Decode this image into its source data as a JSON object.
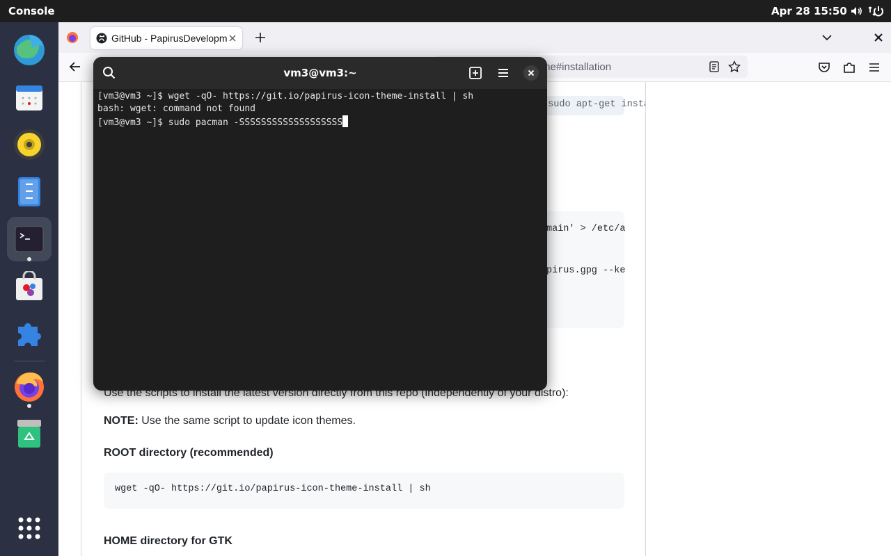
{
  "topbar": {
    "app_name": "Console",
    "datetime": "Apr 28  15:50",
    "icons": [
      "volume-icon",
      "network-icon",
      "power-icon"
    ]
  },
  "dock": {
    "items": [
      {
        "name": "browser-globe",
        "running": false
      },
      {
        "name": "calendar",
        "running": false
      },
      {
        "name": "music-player",
        "running": false
      },
      {
        "name": "file-manager",
        "running": false
      },
      {
        "name": "terminal",
        "running": true
      },
      {
        "name": "software-store",
        "running": false
      },
      {
        "name": "extensions",
        "running": false
      },
      {
        "name": "firefox",
        "running": true
      },
      {
        "name": "trash",
        "running": false
      },
      {
        "name": "app-grid",
        "running": false
      }
    ]
  },
  "browser": {
    "tab_title": "GitHub - PapirusDevelopmentTeam",
    "url_visible": "me#installation",
    "page": {
      "partial_code_top": "/ sudo apt-get install papirus",
      "partial_code_lines": [
        "main' > /etc/a",
        "pirus.gpg --ke"
      ],
      "intro_text": "Use the scripts to install the latest version directly from this repo (independently of your distro):",
      "note_label": "NOTE:",
      "note_text": " Use the same script to update icon themes.",
      "root_heading": "ROOT directory (recommended)",
      "root_command": "wget -qO- https://git.io/papirus-icon-theme-install | sh",
      "home_heading": "HOME directory for GTK"
    }
  },
  "terminal": {
    "title": "vm3@vm3:~",
    "lines": [
      "[vm3@vm3 ~]$ wget -qO- https://git.io/papirus-icon-theme-install | sh",
      "bash: wget: command not found",
      "[vm3@vm3 ~]$ sudo pacman -SSSSSSSSSSSSSSSSSSS"
    ]
  },
  "colors": {
    "topbar": "#1e1e1e",
    "dock": "#2b3142",
    "terminal_bg": "#1e1e1e",
    "terminal_header": "#2a2a2a"
  }
}
